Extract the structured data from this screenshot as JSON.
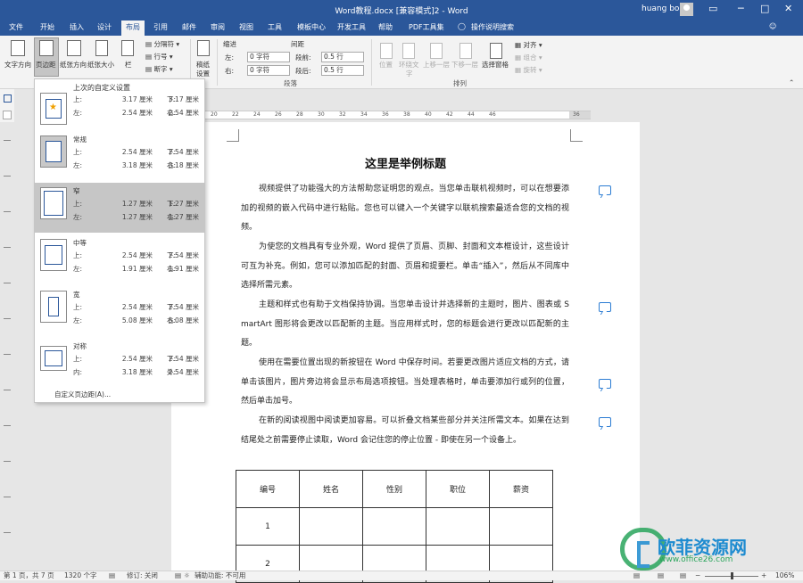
{
  "titlebar": {
    "title": "Word教程.docx [兼容模式]2 - Word",
    "user": "huang bo",
    "restore_glyph": "▭",
    "minimize_glyph": "─",
    "maximize_glyph": "□",
    "close_glyph": "✕"
  },
  "tabs": [
    {
      "label": "文件"
    },
    {
      "label": "开始"
    },
    {
      "label": "插入"
    },
    {
      "label": "设计"
    },
    {
      "label": "布局"
    },
    {
      "label": "引用"
    },
    {
      "label": "邮件"
    },
    {
      "label": "审阅"
    },
    {
      "label": "视图"
    },
    {
      "label": "工具"
    },
    {
      "label": "模板中心"
    },
    {
      "label": "开发工具"
    },
    {
      "label": "帮助"
    },
    {
      "label": "PDF工具集"
    },
    {
      "label": "操作说明搜索"
    }
  ],
  "ribbon": {
    "text_direction": "文字方向",
    "margins": "页边距",
    "orientation": "纸张方向",
    "size": "纸张大小",
    "columns": "栏",
    "breaks": "分隔符",
    "line_numbers": "行号",
    "hyphenation": "断字",
    "manuscript": "稿纸",
    "manuscript2": "设置",
    "indent_title": "缩进",
    "spacing_title": "间距",
    "indent_left_label": "左:",
    "indent_left_value": "0 字符",
    "indent_right_label": "右:",
    "indent_right_value": "0 字符",
    "spacing_before_label": "段前:",
    "spacing_before_value": "0.5 行",
    "spacing_after_label": "段后:",
    "spacing_after_value": "0.5 行",
    "group_paragraph": "段落",
    "position": "位置",
    "wrap": "环绕文",
    "wrap2": "字",
    "forward": "上移一层",
    "backward": "下移一层",
    "select_pane": "选择窗格",
    "align": "对齐",
    "group_btn": "组合",
    "rotate": "旋转",
    "group_arrange": "排列"
  },
  "margins_menu": {
    "last_custom": "上次的自定义设置",
    "options": [
      {
        "name": "",
        "k1": "上:",
        "v1": "3.17 厘米",
        "k2": "下:",
        "v2": "3.17 厘米",
        "k3": "左:",
        "v3": "2.54 厘米",
        "k4": "右:",
        "v4": "2.54 厘米"
      },
      {
        "name": "常规",
        "k1": "上:",
        "v1": "2.54 厘米",
        "k2": "下:",
        "v2": "2.54 厘米",
        "k3": "左:",
        "v3": "3.18 厘米",
        "k4": "右:",
        "v4": "3.18 厘米"
      },
      {
        "name": "窄",
        "k1": "上:",
        "v1": "1.27 厘米",
        "k2": "下:",
        "v2": "1.27 厘米",
        "k3": "左:",
        "v3": "1.27 厘米",
        "k4": "右:",
        "v4": "1.27 厘米"
      },
      {
        "name": "中等",
        "k1": "上:",
        "v1": "2.54 厘米",
        "k2": "下:",
        "v2": "2.54 厘米",
        "k3": "左:",
        "v3": "1.91 厘米",
        "k4": "右:",
        "v4": "1.91 厘米"
      },
      {
        "name": "宽",
        "k1": "上:",
        "v1": "2.54 厘米",
        "k2": "下:",
        "v2": "2.54 厘米",
        "k3": "左:",
        "v3": "5.08 厘米",
        "k4": "右:",
        "v4": "5.08 厘米"
      },
      {
        "name": "对称",
        "k1": "上:",
        "v1": "2.54 厘米",
        "k2": "下:",
        "v2": "2.54 厘米",
        "k3": "内:",
        "v3": "3.18 厘米",
        "k4": "外:",
        "v4": "2.54 厘米"
      }
    ],
    "custom": "自定义页边距(A)..."
  },
  "ruler": {
    "numbers": [
      "20",
      "22",
      "24",
      "26",
      "28",
      "30",
      "32",
      "34",
      "36",
      "38",
      "40",
      "42",
      "44",
      "46"
    ],
    "right_numbers": [
      "36",
      "38",
      "40",
      "42",
      "44",
      "46"
    ]
  },
  "document": {
    "title": "这里是举例标题",
    "paragraphs": [
      "视频提供了功能强大的方法帮助您证明您的观点。当您单击联机视频时，可以在想要添加的视频的嵌入代码中进行粘贴。您也可以键入一个关键字以联机搜索最适合您的文档的视频。",
      "为使您的文档具有专业外观，Word 提供了页眉、页脚、封面和文本框设计，这些设计可互为补充。例如，您可以添加匹配的封面、页眉和提要栏。单击“插入”，然后从不同库中选择所需元素。",
      "主题和样式也有助于文档保持协调。当您单击设计并选择新的主题时，图片、图表或 SmartArt 图形将会更改以匹配新的主题。当应用样式时，您的标题会进行更改以匹配新的主题。",
      "使用在需要位置出现的新按钮在 Word 中保存时间。若要更改图片适应文档的方式，请单击该图片，图片旁边将会显示布局选项按钮。当处理表格时，单击要添加行或列的位置，然后单击加号。",
      "在新的阅读视图中阅读更加容易。可以折叠文档某些部分并关注所需文本。如果在达到结尾处之前需要停止读取，Word 会记住您的停止位置 - 即使在另一个设备上。"
    ],
    "table": {
      "headers": [
        "编号",
        "姓名",
        "性别",
        "职位",
        "薪资"
      ],
      "rows": [
        [
          "1",
          "",
          "",
          "",
          ""
        ],
        [
          "2",
          "",
          "",
          "",
          ""
        ]
      ]
    }
  },
  "status": {
    "page": "第 1 页，共 7 页",
    "words": "1320 个字",
    "track": "修订: 关闭",
    "accessibility": "辅助功能: 不可用",
    "zoom": "106%",
    "zoom_out": "−",
    "zoom_in": "+"
  },
  "watermark": {
    "cn": "欧菲资源网",
    "en": "www.office26.com"
  }
}
